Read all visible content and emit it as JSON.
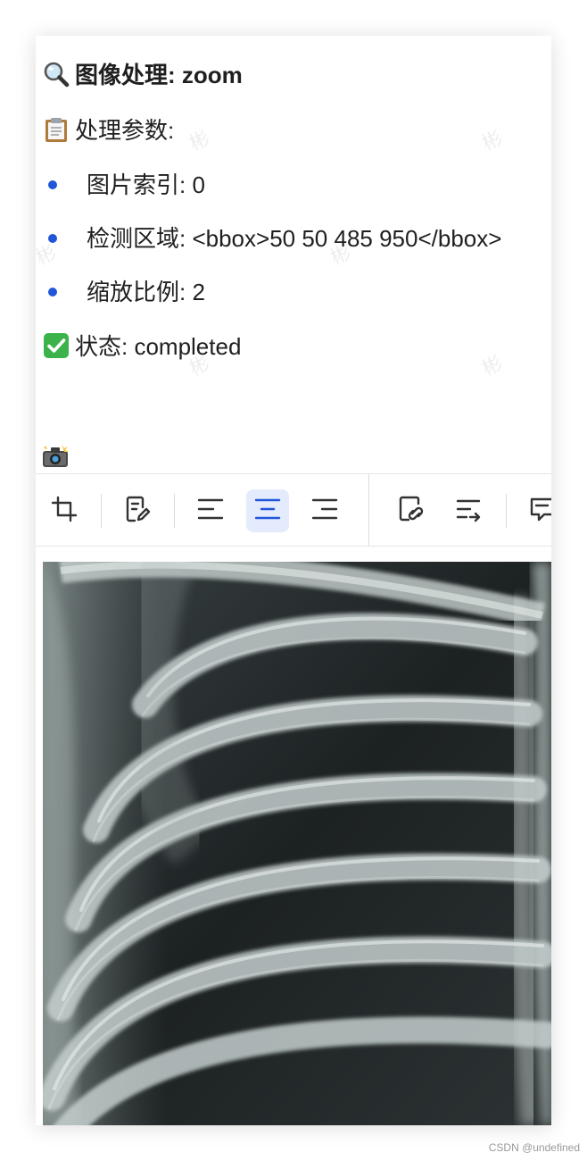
{
  "title": {
    "icon": "magnifier-icon",
    "text": "图像处理: zoom"
  },
  "params": {
    "icon": "clipboard-icon",
    "label": "处理参数:",
    "items": [
      {
        "text": "图片索引: 0"
      },
      {
        "text": "检测区域: <bbox>50 50 485 950</bbox>"
      },
      {
        "text": "缩放比例: 2"
      }
    ]
  },
  "status": {
    "icon": "check-mark-icon",
    "text": "状态: completed"
  },
  "camera_icon": "camera-flash-icon",
  "toolbar": {
    "buttons": [
      {
        "name": "crop-button",
        "icon": "crop-icon",
        "active": false
      },
      {
        "name": "edit-caption-button",
        "icon": "edit-note-icon",
        "active": false
      },
      {
        "name": "align-left-button",
        "icon": "align-left-icon",
        "active": false
      },
      {
        "name": "align-center-button",
        "icon": "align-center-icon",
        "active": true
      },
      {
        "name": "align-right-button",
        "icon": "align-right-icon",
        "active": false
      },
      {
        "name": "link-button",
        "icon": "link-icon",
        "active": false
      },
      {
        "name": "text-wrap-button",
        "icon": "text-wrap-icon",
        "active": false
      },
      {
        "name": "comment-button",
        "icon": "comment-icon",
        "active": false
      }
    ],
    "active_color": "#2156d9"
  },
  "image": {
    "subject": "chest x-ray ribs"
  },
  "watermark_text": "彬",
  "credit": "CSDN @undefined",
  "colors": {
    "bullet": "#2156d9",
    "text": "#1f1f1f",
    "active_bg": "#e3ebfc"
  }
}
